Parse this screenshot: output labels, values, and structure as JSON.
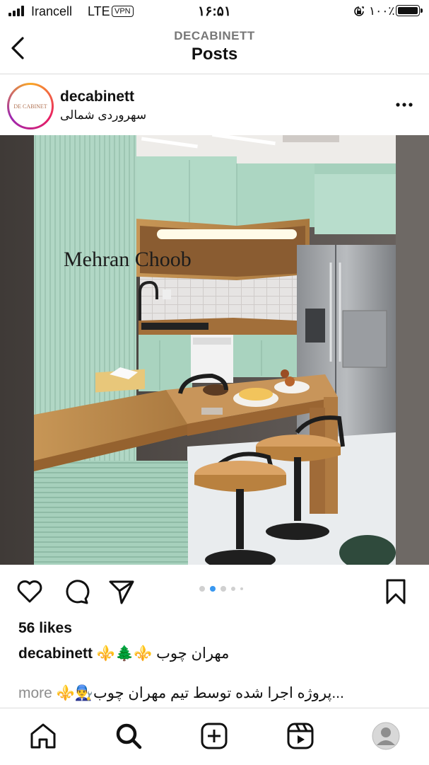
{
  "status": {
    "carrier": "Irancell",
    "network": "LTE",
    "vpn": "VPN",
    "time": "۱۶:۵۱",
    "battery": "۱۰۰٪"
  },
  "header": {
    "subtitle": "DECABINETT",
    "title": "Posts",
    "back_icon": "chevron-left-icon"
  },
  "post": {
    "username": "decabinett",
    "location": "سهروردی شمالی",
    "avatar_text": "DE CABINET",
    "watermark": "Mehran Choob",
    "carousel": {
      "count": 5,
      "active_index": 1
    },
    "likes": "56 likes",
    "caption_user": "decabinett",
    "caption_text": "⚜️🌲⚜️ مهران چوب",
    "caption_line2": "⚜️👨‍🔧پروژه اجرا شده توسط تیم مهران چوب...",
    "more_label": "more"
  },
  "actions": {
    "like": "heart-icon",
    "comment": "comment-icon",
    "share": "send-icon",
    "save": "bookmark-icon"
  },
  "tabbar": [
    "home-icon",
    "search-icon",
    "add-icon",
    "reels-icon",
    "profile-icon"
  ],
  "colors": {
    "accent": "#3897f0",
    "cabinet": "#a9d3bf",
    "wood": "#b98a4f"
  }
}
